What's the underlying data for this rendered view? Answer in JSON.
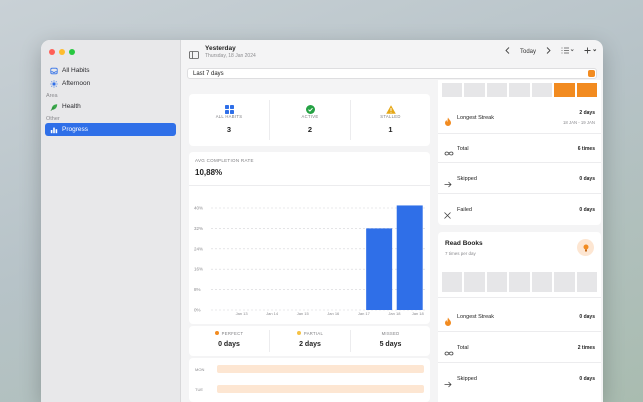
{
  "sidebar": {
    "items": [
      {
        "label": "All Habits",
        "icon": "tray-icon"
      },
      {
        "label": "Afternoon",
        "icon": "sun-icon"
      }
    ],
    "section_area": "Area",
    "area_items": [
      {
        "label": "Health",
        "icon": "leaf-icon"
      }
    ],
    "section_other": "Other",
    "other_items": [
      {
        "label": "Progress",
        "icon": "chart-icon"
      }
    ]
  },
  "toolbar": {
    "title": "Yesterday",
    "subtitle": "Thursday, 18 Jan 2024",
    "today": "Today"
  },
  "period": {
    "value": "Last 7 days"
  },
  "summary": {
    "stats": [
      {
        "label": "ALL HABITS",
        "value": "3",
        "color": "#2f6fe8"
      },
      {
        "label": "ACTIVE",
        "value": "2",
        "color": "#25a244"
      },
      {
        "label": "STALLED",
        "value": "1",
        "color": "#e6a817"
      }
    ]
  },
  "completion": {
    "label": "AVG COMPLETION RATE",
    "value": "10,88%"
  },
  "chart_data": {
    "type": "bar",
    "categories": [
      "Jan 12",
      "Jan 13",
      "Jan 14",
      "Jan 15",
      "Jan 16",
      "Jan 17",
      "Jan 18"
    ],
    "values": [
      0,
      0,
      0,
      0,
      0,
      32,
      41
    ],
    "y_ticks": [
      "0%",
      "8%",
      "16%",
      "24%",
      "32%",
      "40%"
    ],
    "ylim": [
      0,
      40
    ],
    "bar_color": "#2f6fe8"
  },
  "legend": {
    "items": [
      {
        "label": "PERFECT",
        "value": "0 days",
        "color": "#f28b20"
      },
      {
        "label": "PARTIAL",
        "value": "2 days",
        "color": "#f6c244"
      },
      {
        "label": "MISSED",
        "value": "5 days",
        "color": "#c8c8cc"
      }
    ]
  },
  "heat_rows": [
    "MON",
    "TUE"
  ],
  "habit1": {
    "bar_colors": [
      "#e6e6e8",
      "#e6e6e8",
      "#e6e6e8",
      "#e6e6e8",
      "#e6e6e8",
      "#f28b20",
      "#f28b20"
    ],
    "rows": [
      {
        "label": "Longest Streak",
        "value": "2 days",
        "sub": "18 JAN - 19 JAN",
        "icon": "flame-icon"
      },
      {
        "label": "Total",
        "value": "6 times",
        "icon": "infinity-icon"
      },
      {
        "label": "Skipped",
        "value": "0 days",
        "icon": "arrow-right-icon"
      },
      {
        "label": "Failed",
        "value": "0 days",
        "icon": "x-icon"
      }
    ]
  },
  "habit2": {
    "name": "Read Books",
    "frequency": "7 times per day",
    "rows": [
      {
        "label": "Longest Streak",
        "value": "0 days",
        "icon": "flame-icon"
      },
      {
        "label": "Total",
        "value": "2 times",
        "icon": "infinity-icon"
      },
      {
        "label": "Skipped",
        "value": "0 days",
        "icon": "arrow-right-icon"
      }
    ]
  }
}
